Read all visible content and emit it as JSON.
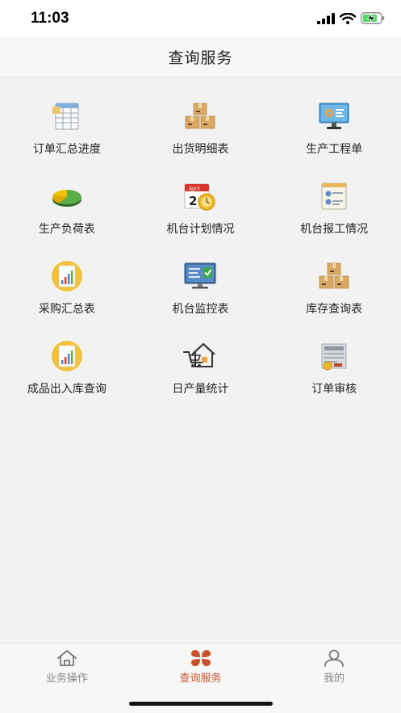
{
  "status_bar": {
    "time": "11:03"
  },
  "header": {
    "title": "查询服务"
  },
  "menu": [
    {
      "label": "订单汇总进度",
      "icon": "spreadsheet-icon"
    },
    {
      "label": "出货明细表",
      "icon": "boxes-icon"
    },
    {
      "label": "生产工程单",
      "icon": "monitor-gear-icon"
    },
    {
      "label": "生产负荷表",
      "icon": "pie-chart-icon"
    },
    {
      "label": "机台计划情况",
      "icon": "calendar-clock-icon"
    },
    {
      "label": "机台报工情况",
      "icon": "report-card-icon"
    },
    {
      "label": "采购汇总表",
      "icon": "bar-report-icon"
    },
    {
      "label": "机台监控表",
      "icon": "monitor-check-icon"
    },
    {
      "label": "库存查询表",
      "icon": "boxes-icon"
    },
    {
      "label": "成品出入库查询",
      "icon": "bar-report-icon"
    },
    {
      "label": "日产量统计",
      "icon": "cart-house-icon"
    },
    {
      "label": "订单审核",
      "icon": "audit-document-icon"
    }
  ],
  "tabbar": {
    "items": [
      {
        "label": "业务操作",
        "icon": "home-icon"
      },
      {
        "label": "查询服务",
        "icon": "clover-icon"
      },
      {
        "label": "我的",
        "icon": "person-icon"
      }
    ],
    "active_index": 1,
    "active_color": "#c8532b",
    "inactive_color": "#888888"
  }
}
